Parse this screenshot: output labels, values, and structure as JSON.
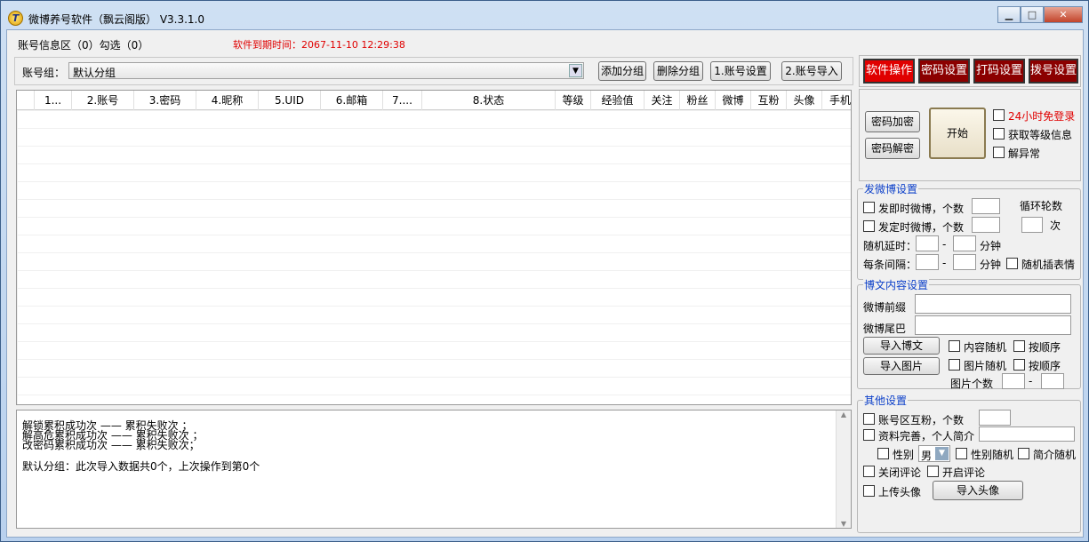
{
  "window": {
    "title": "微博养号软件（飘云阁版） V3.3.1.0"
  },
  "top_info": {
    "account_info": "账号信息区（0）勾选（0）",
    "expire": "软件到期时间：2067-11-10 12:29:38"
  },
  "group_bar": {
    "label": "账号组：",
    "selected": "默认分组",
    "add": "添加分组",
    "delete": "删除分组",
    "acct_settings": "1.账号设置",
    "import": "2.账号导入"
  },
  "table": {
    "columns": [
      "1...",
      "2.账号",
      "3.密码",
      "4.昵称",
      "5.UID",
      "6.邮箱",
      "7....",
      "8.状态",
      "等级",
      "经验值",
      "关注",
      "粉丝",
      "微博",
      "互粉",
      "头像",
      "手机"
    ]
  },
  "log": {
    "lines": [
      "解锁累积成功次 —— 累积失败次 ；",
      "解高危累积成功次 —— 累积失败次 ；",
      "改密码累积成功次 —— 累积失败次；",
      "",
      "默认分组：此次导入数据共0个，上次操作到第0个"
    ]
  },
  "tabs": [
    "软件操作",
    "密码设置",
    "打码设置",
    "拨号设置"
  ],
  "ops": {
    "encrypt": "密码加密",
    "decrypt": "密码解密",
    "start": "开始",
    "opt1": "24小时免登录",
    "opt2": "获取等级信息",
    "opt3": "解异常"
  },
  "weibo": {
    "title": "发微博设置",
    "instant": "发即时微博，个数",
    "timed": "发定时微博，个数",
    "loop": "循环轮数",
    "times": "次",
    "delay": "随机延时：",
    "interval": "每条间隔：",
    "dash": "-",
    "minute": "分钟",
    "emoji": "随机插表情"
  },
  "content": {
    "title": "博文内容设置",
    "prefix": "微博前缀",
    "suffix": "微博尾巴",
    "import_text": "导入博文",
    "import_img": "导入图片",
    "rand_content": "内容随机",
    "seq1": "按顺序",
    "rand_img": "图片随机",
    "seq2": "按顺序",
    "img_count": "图片个数",
    "dash": "-"
  },
  "other": {
    "title": "其他设置",
    "mutual": "账号区互粉，个数",
    "profile": "资料完善，个人简介",
    "gender": "性别",
    "gender_value": "男",
    "rand_gender": "性别随机",
    "rand_intro": "简介随机",
    "close_comment": "关闭评论",
    "open_comment": "开启评论",
    "upload_avatar": "上传头像",
    "import_avatar": "导入头像"
  },
  "colors": {
    "tab_active": "#e00000",
    "tab_inactive": "#8b0000",
    "expire_text": "#e00000",
    "group_title": "#0b3fc9"
  }
}
